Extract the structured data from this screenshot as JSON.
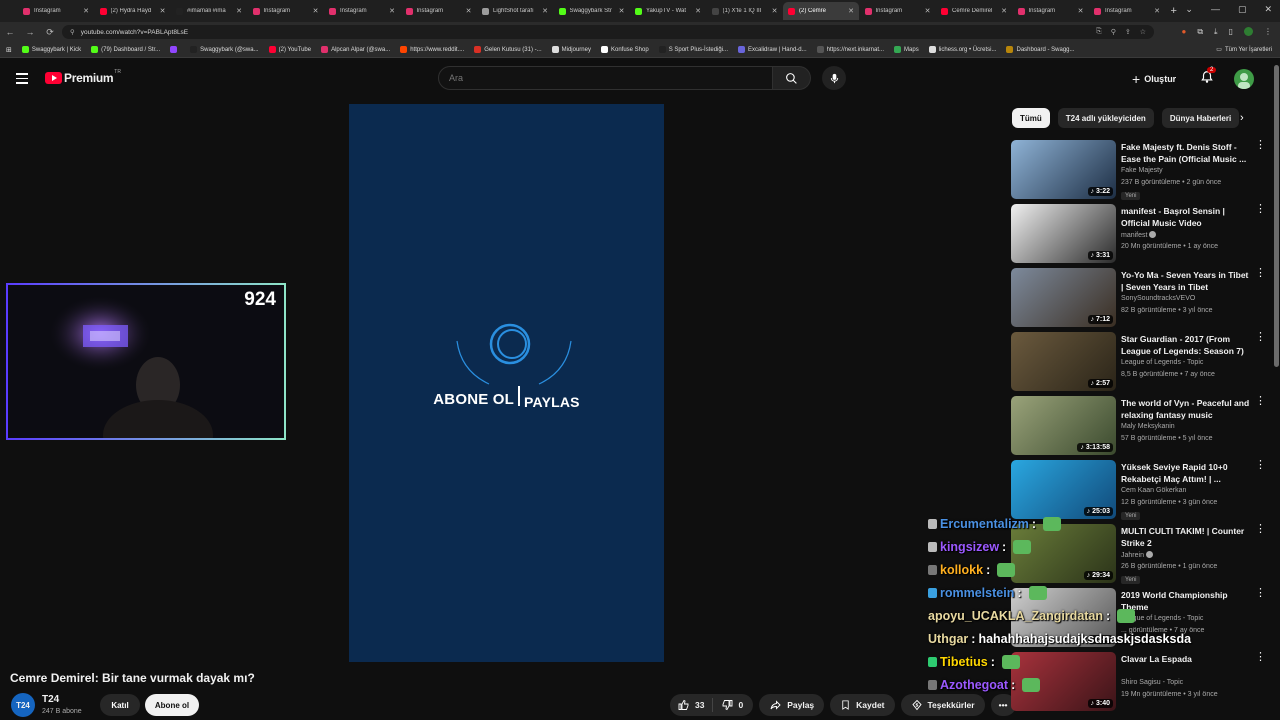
{
  "browser": {
    "tabs": [
      {
        "title": "Instagram",
        "color": "#e1306c"
      },
      {
        "title": "(2) Hydra Hayd",
        "color": "#ff0033"
      },
      {
        "title": "#imamali #ima",
        "color": "#222222"
      },
      {
        "title": "Instagram",
        "color": "#e1306c"
      },
      {
        "title": "Instagram",
        "color": "#e1306c"
      },
      {
        "title": "Instagram",
        "color": "#e1306c"
      },
      {
        "title": "LightShot tarafı",
        "color": "#9c9c9c"
      },
      {
        "title": "Swaggybark Str",
        "color": "#53fc18"
      },
      {
        "title": "YakupTV - Wat",
        "color": "#53fc18"
      },
      {
        "title": "(1) X'te 1 IQ III",
        "color": "#444444"
      },
      {
        "title": "(2) Cemre",
        "color": "#ff0033"
      },
      {
        "title": "Instagram",
        "color": "#e1306c"
      },
      {
        "title": "Cemre Demirel",
        "color": "#ff0033"
      },
      {
        "title": "Instagram",
        "color": "#e1306c"
      },
      {
        "title": "Instagram",
        "color": "#e1306c"
      }
    ],
    "active_tab": 10,
    "url": "youtube.com/watch?v=PABLApt8LsE",
    "bookmarks": [
      {
        "label": "Swaggybark | Kick",
        "color": "#53fc18"
      },
      {
        "label": "(79) Dashboard / Str...",
        "color": "#53fc18"
      },
      {
        "label": "",
        "color": "#9146ff"
      },
      {
        "label": "Swaggybark (@swa...",
        "color": "#222222"
      },
      {
        "label": "(2) YouTube",
        "color": "#ff0033"
      },
      {
        "label": "Alpcan Alpar (@swa...",
        "color": "#e1306c"
      },
      {
        "label": "https://www.reddit....",
        "color": "#ff4500"
      },
      {
        "label": "Gelen Kutusu (31) -...",
        "color": "#d93025"
      },
      {
        "label": "Midjourney",
        "color": "#dddddd"
      },
      {
        "label": "Konfuse Shop",
        "color": "#ffffff"
      },
      {
        "label": "S Sport Plus-İstediği...",
        "color": "#222222"
      },
      {
        "label": "Excalidraw | Hand-d...",
        "color": "#6965db"
      },
      {
        "label": "https://next.inkarnat...",
        "color": "#555555"
      },
      {
        "label": "Maps",
        "color": "#34a853"
      },
      {
        "label": "lichess.org • Ücretsi...",
        "color": "#dddddd"
      },
      {
        "label": "Dashboard - Swagg...",
        "color": "#b8860b"
      }
    ],
    "all_bookmarks": "Tüm Yer İşaretleri"
  },
  "header": {
    "logo_text": "Premium",
    "region": "TR",
    "search_placeholder": "Ara",
    "create_label": "Oluştur",
    "notifications": "2"
  },
  "video": {
    "overlay_left": "ABONE OL",
    "overlay_right": "PAYLAS",
    "title": "Cemre Demirel: Bir tane vurmak dayak mı?",
    "channel": "T24",
    "channel_avatar_text": "T24",
    "subscribers": "247 B abone",
    "join_label": "Katıl",
    "subscribe_label": "Abone ol",
    "likes": "33",
    "dislikes": "0",
    "share_label": "Paylaş",
    "save_label": "Kaydet",
    "thanks_label": "Teşekkürler",
    "more_label": "•••"
  },
  "webcam": {
    "counter": "924"
  },
  "sidebar": {
    "chips": [
      "Tümü",
      "T24 adlı yükleyiciden",
      "Dünya Haberleri"
    ],
    "recommendations": [
      {
        "title": "Fake Majesty ft. Denis Stoff - Ease the Pain (Official Music ...",
        "channel": "Fake Majesty",
        "meta": "237 B görüntüleme • 2 gün önce",
        "badge": "Yeni",
        "duration": "3:22",
        "verified": false,
        "colors": [
          "#8fb3d6",
          "#1d2e44"
        ]
      },
      {
        "title": "manifest - Başrol Sensin | Official Music Video",
        "channel": "manifest",
        "meta": "20 Mn görüntüleme • 1 ay önce",
        "badge": "",
        "duration": "3:31",
        "verified": true,
        "colors": [
          "#f0f0f0",
          "#2b2b2b"
        ]
      },
      {
        "title": "Yo-Yo Ma - Seven Years in Tibet | Seven Years in Tibet (Original...",
        "channel": "SonySoundtracksVEVO",
        "meta": "82 B görüntüleme • 3 yıl önce",
        "badge": "",
        "duration": "7:12",
        "verified": false,
        "colors": [
          "#7d8a9c",
          "#3a2e22"
        ]
      },
      {
        "title": "Star Guardian - 2017 (From League of Legends: Season 7)",
        "channel": "League of Legends - Topic",
        "meta": "8,5 B görüntüleme • 7 ay önce",
        "badge": "",
        "duration": "2:57",
        "verified": false,
        "colors": [
          "#6b5a3e",
          "#2a2418"
        ]
      },
      {
        "title": "The world of Vyn - Peaceful and relaxing fantasy music (Enderal)",
        "channel": "Maly Meksykanin",
        "meta": "57 B görüntüleme • 5 yıl önce",
        "badge": "",
        "duration": "3:13:58",
        "verified": false,
        "colors": [
          "#9aa37a",
          "#3b4a2e"
        ]
      },
      {
        "title": "Yüksek Seviye Rapid 10+0 Rekabetçi Maç Attım! | ...",
        "channel": "Cem Kaan Gökerkan",
        "meta": "12 B görüntüleme • 3 gün önce",
        "badge": "Yeni",
        "duration": "25:03",
        "verified": false,
        "colors": [
          "#2aa7e0",
          "#114a7a"
        ]
      },
      {
        "title": "MULTI CULTI TAKIM! | Counter Strike 2",
        "channel": "Jahrein",
        "meta": "26 B görüntüleme • 1 gün önce",
        "badge": "Yeni",
        "duration": "29:34",
        "verified": true,
        "colors": [
          "#6a7d3a",
          "#2b3319"
        ]
      },
      {
        "title": "2019 World Championship Theme",
        "channel": "League of Legends - Topic",
        "meta": "... görüntüleme • 7 ay önce",
        "badge": "",
        "duration": "2:40",
        "verified": false,
        "colors": [
          "#cfcfcf",
          "#555555"
        ]
      },
      {
        "title": "Clavar La Espada",
        "channel": "Shiro Sagisu - Topic",
        "meta": "19 Mn görüntüleme • 3 yıl önce",
        "badge": "",
        "duration": "3:40",
        "verified": false,
        "colors": [
          "#a8323c",
          "#3a1418"
        ]
      }
    ]
  },
  "chat": [
    {
      "user": "Ercumentalizm",
      "color": "#4a90e2",
      "message": "",
      "badge_color": "#bbbbbb"
    },
    {
      "user": "kingsizew",
      "color": "#9b59ff",
      "message": "",
      "badge_color": "#bbbbbb"
    },
    {
      "user": "kollokk",
      "color": "#ffb020",
      "message": "",
      "badge_color": "#777777"
    },
    {
      "user": "rommelstein",
      "color": "#4a90e2",
      "message": "",
      "badge_color": "#3aa0e0"
    },
    {
      "user": "apoyu_UCAKLA_Zangirdatan",
      "color": "#e8d9a0",
      "message": "",
      "badge_color": ""
    },
    {
      "user": "Uthgar",
      "color": "#e8d9a0",
      "message": "hahahhahajsudajksdnaskjsdasksda",
      "badge_color": ""
    },
    {
      "user": "Tibetius",
      "color": "#ffd700",
      "message": "",
      "badge_color": "#2ecc71"
    },
    {
      "user": "Azothegoat",
      "color": "#9b59ff",
      "message": "",
      "badge_color": "#777777"
    }
  ]
}
